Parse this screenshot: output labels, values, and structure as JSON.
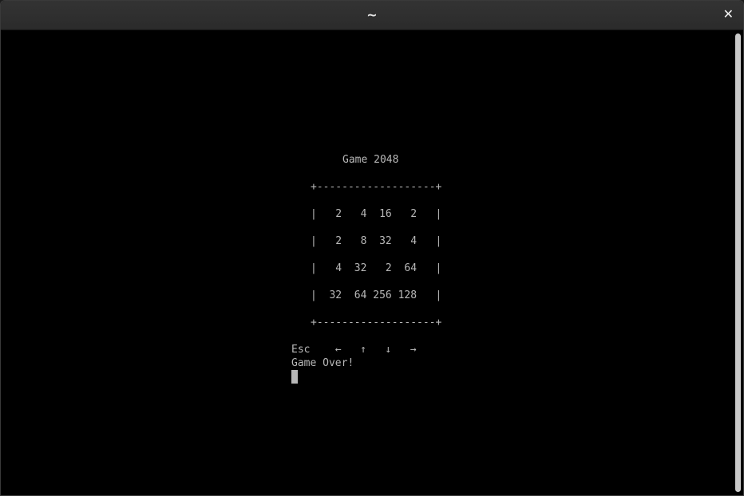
{
  "window": {
    "title": "~",
    "close_glyph": "✕"
  },
  "game": {
    "title": "Game 2048",
    "border_top": "+-------------------+",
    "rows": [
      "|   2   4  16   2   |",
      "|   2   8  32   4   |",
      "|   4  32   2  64   |",
      "|  32  64 256 128   |"
    ],
    "border_bottom": "+-------------------+",
    "board_values": [
      [
        2,
        4,
        16,
        2
      ],
      [
        2,
        8,
        32,
        4
      ],
      [
        4,
        32,
        2,
        64
      ],
      [
        32,
        64,
        256,
        128
      ]
    ],
    "controls": "Esc    ←   ↑   ↓   →",
    "status": "Game Over!"
  },
  "colors": {
    "terminal_bg": "#000000",
    "terminal_fg": "#b8b8b8",
    "titlebar_bg": "#2e2e2e"
  },
  "icons": {
    "close": "close-icon",
    "cursor": "block-cursor"
  }
}
